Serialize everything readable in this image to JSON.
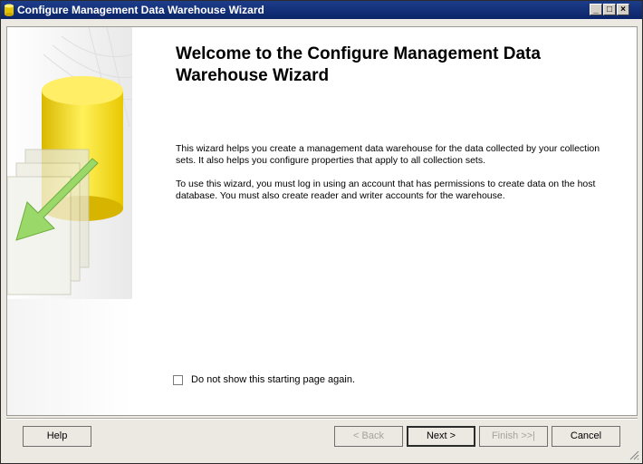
{
  "window": {
    "title": "Configure Management Data Warehouse Wizard"
  },
  "page": {
    "heading": "Welcome to the Configure Management Data Warehouse Wizard",
    "paragraph1": "This wizard helps you create a management data warehouse for the data collected by your collection sets. It also helps you configure properties that apply to all collection sets.",
    "paragraph2": "To use this wizard, you must log in using an account that has permissions to create data on the host database. You must also create reader and writer accounts for the warehouse.",
    "checkbox_label": "Do not show this starting page again."
  },
  "buttons": {
    "help": "Help",
    "back": "< Back",
    "next": "Next >",
    "finish": "Finish >>|",
    "cancel": "Cancel"
  },
  "icons": {
    "title_icon": "database-icon",
    "side_art": "database-cylinder-arrow-graphic"
  },
  "colors": {
    "titlebar": "#0b2469",
    "cylinder": "#f2d600",
    "arrow": "#8fd160"
  }
}
